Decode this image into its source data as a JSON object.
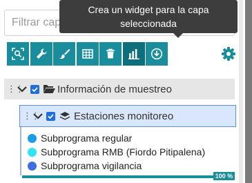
{
  "search": {
    "placeholder": "Filtrar capas"
  },
  "tooltip": {
    "line1": "Crea un widget para la capa",
    "line2": "seleccionada"
  },
  "toolbar": {
    "buttons": [
      {
        "name": "zoom-to-layer-icon"
      },
      {
        "name": "wrench-icon"
      },
      {
        "name": "paint-brush-icon"
      },
      {
        "name": "table-icon"
      },
      {
        "name": "trash-icon"
      },
      {
        "name": "bar-chart-icon"
      },
      {
        "name": "download-icon"
      }
    ],
    "accent": "#1a8d9c"
  },
  "group": {
    "label": "Información de muestreo"
  },
  "layer": {
    "label": "Estaciones monitoreo"
  },
  "legend": [
    {
      "label": "Subprograma regular",
      "color": "#1e9be8"
    },
    {
      "label": "Subprograma RMB (Fiordo Pitipalena)",
      "color": "#2ee6f2"
    },
    {
      "label": "Subprograma vigilancia",
      "color": "#3d6fe0"
    }
  ],
  "progress": {
    "value": 1.0,
    "label": "100 %"
  }
}
